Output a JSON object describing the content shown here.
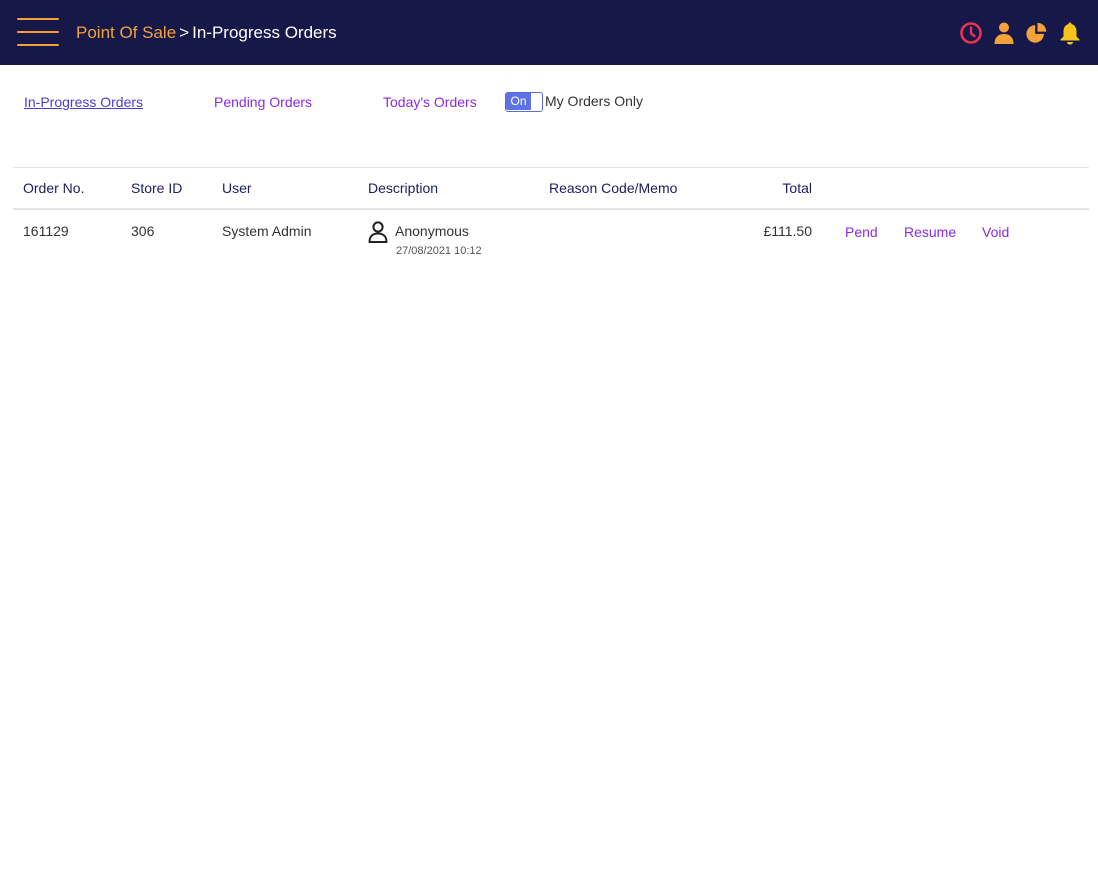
{
  "header": {
    "breadcrumb_root": "Point Of Sale",
    "breadcrumb_separator": ">",
    "breadcrumb_current": "In-Progress Orders",
    "icons": [
      "clock-icon",
      "user-icon",
      "pie-chart-icon",
      "bell-icon"
    ],
    "colors": {
      "background": "#16184a",
      "accent": "#f4a13a",
      "clock": "#e8344e"
    }
  },
  "subnav": {
    "links": [
      {
        "label": "In-Progress Orders",
        "active": true
      },
      {
        "label": "Pending Orders",
        "active": false
      },
      {
        "label": "Today's Orders",
        "active": false
      }
    ],
    "toggle": {
      "state_label": "On",
      "label": "My Orders Only"
    }
  },
  "table": {
    "columns": [
      "Order No.",
      "Store ID",
      "User",
      "Description",
      "Reason Code/Memo",
      "Total"
    ],
    "rows": [
      {
        "order_no": "161129",
        "store_id": "306",
        "user": "System Admin",
        "description_name": "Anonymous",
        "description_date": "27/08/2021 10:12",
        "reason": "",
        "total": "£111.50",
        "actions": [
          "Pend",
          "Resume",
          "Void"
        ]
      }
    ]
  }
}
